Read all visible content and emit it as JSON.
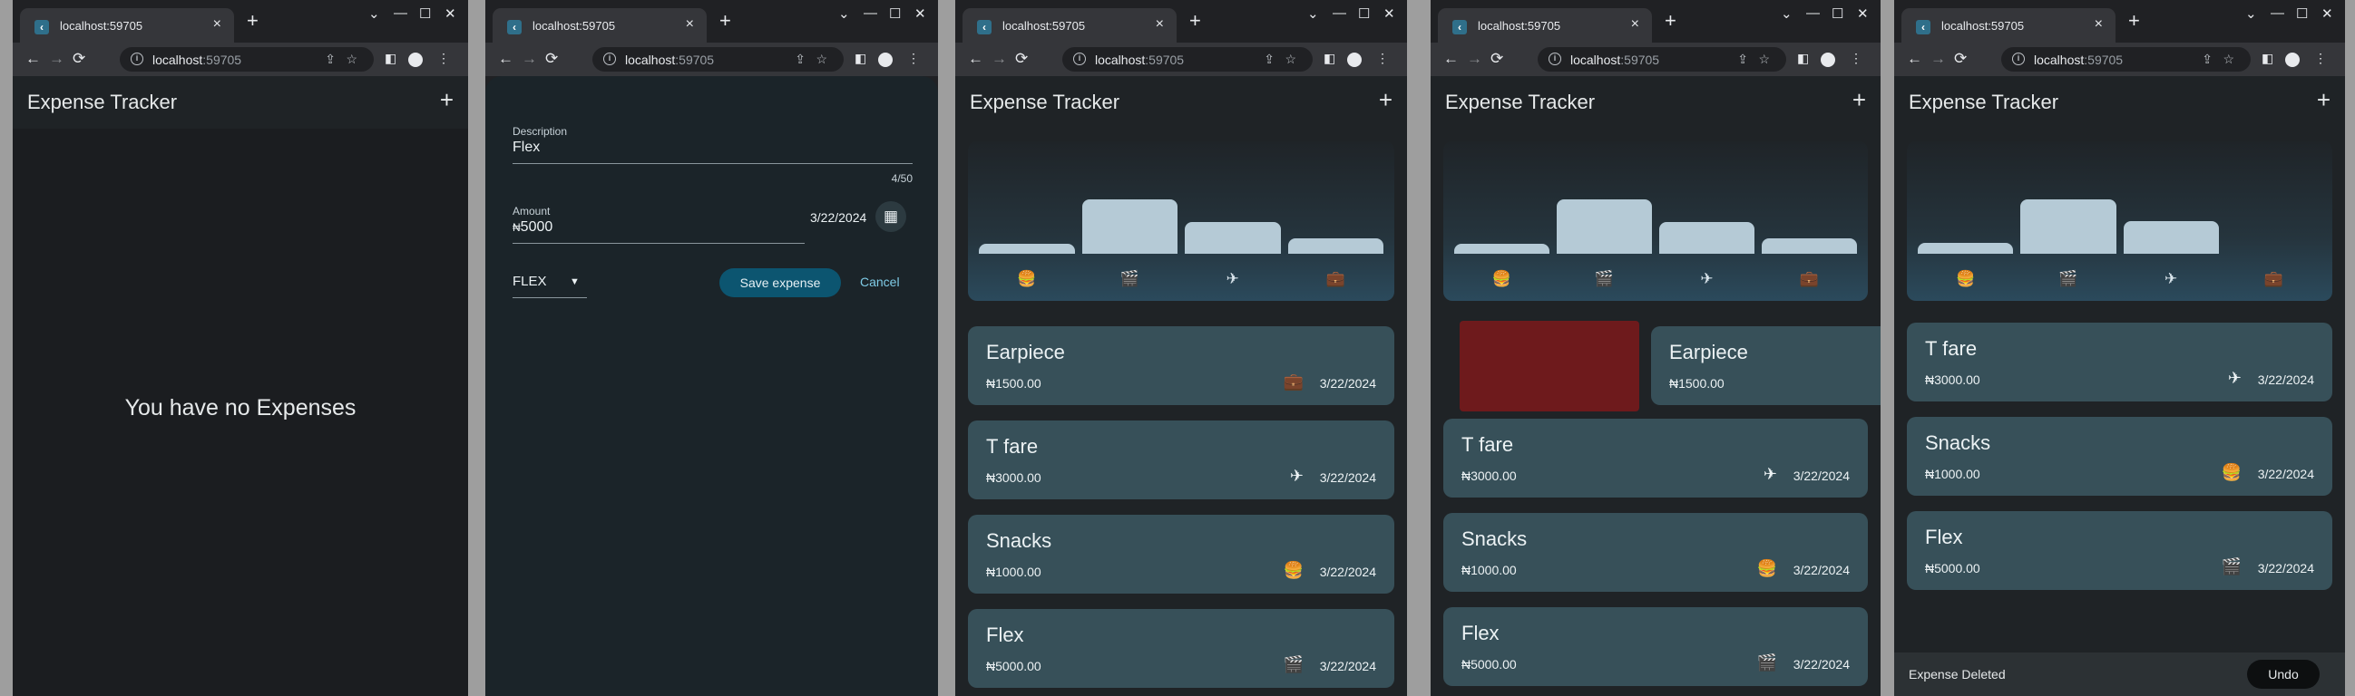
{
  "browser": {
    "tab_title": "localhost:59705",
    "favicon": "flutter-icon",
    "url_host": "localhost",
    "url_port": ":59705",
    "new_tab": "+",
    "close_tab": "×",
    "minimize": "⌄",
    "restore_min": "—",
    "maximize": "☐",
    "close_window": "✕",
    "back": "←",
    "forward": "→",
    "reload": "⟳",
    "info": "i",
    "share": "⇪",
    "star": "☆",
    "sidepanel": "◧",
    "menu": "⋮"
  },
  "app": {
    "title": "Expense Tracker",
    "add": "+",
    "empty_message": "You have no Expenses",
    "currency": "₦"
  },
  "form": {
    "description_label": "Description",
    "description_value": "Flex",
    "counter": "4/50",
    "amount_label": "Amount",
    "amount_prefix": "₦",
    "amount_value": "5000",
    "date": "3/22/2024",
    "category": "FLEX",
    "caret": "▼",
    "save": "Save expense",
    "cancel": "Cancel",
    "calendar_icon": "▦"
  },
  "chart_data": [
    {
      "type": "bar",
      "title": "",
      "categories": [
        "food",
        "leisure",
        "travel",
        "work"
      ],
      "values": [
        0.18,
        1.0,
        0.58,
        0.29
      ],
      "ylim": [
        0,
        1
      ]
    },
    {
      "type": "bar",
      "title": "",
      "categories": [
        "food",
        "leisure",
        "travel",
        "work"
      ],
      "values": [
        0.18,
        1.0,
        0.58,
        0.29
      ],
      "ylim": [
        0,
        1
      ]
    },
    {
      "type": "bar",
      "title": "",
      "categories": [
        "food",
        "leisure",
        "travel",
        "work"
      ],
      "values": [
        0.2,
        1.0,
        0.6,
        0.0
      ],
      "ylim": [
        0,
        1
      ]
    }
  ],
  "category_icons": {
    "food": "🍔",
    "leisure": "🎬",
    "travel": "✈",
    "work": "💼"
  },
  "expenses_full": [
    {
      "title": "Earpiece",
      "amount": "₦1500.00",
      "category": "work",
      "date": "3/22/2024"
    },
    {
      "title": "T fare",
      "amount": "₦3000.00",
      "category": "travel",
      "date": "3/22/2024"
    },
    {
      "title": "Snacks",
      "amount": "₦1000.00",
      "category": "food",
      "date": "3/22/2024"
    },
    {
      "title": "Flex",
      "amount": "₦5000.00",
      "category": "leisure",
      "date": "3/22/2024"
    }
  ],
  "expenses_after_delete": [
    {
      "title": "T fare",
      "amount": "₦3000.00",
      "category": "travel",
      "date": "3/22/2024"
    },
    {
      "title": "Snacks",
      "amount": "₦1000.00",
      "category": "food",
      "date": "3/22/2024"
    },
    {
      "title": "Flex",
      "amount": "₦5000.00",
      "category": "leisure",
      "date": "3/22/2024"
    }
  ],
  "snackbar": {
    "message": "Expense Deleted",
    "undo": "Undo"
  }
}
